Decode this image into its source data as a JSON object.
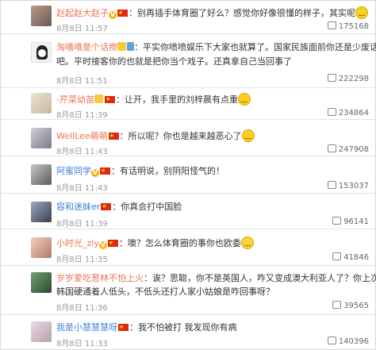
{
  "comments": [
    {
      "user": "赵起赵大赵子",
      "badges": [
        "vip-badge",
        "china-flag"
      ],
      "text": "：别再插手体育圈了好么？感觉你好像很懂的样子，其实呢",
      "emoji_after": true,
      "time": "8月8日 11:57",
      "likes": "175168"
    },
    {
      "user": "淘嘻嘻是个话痨",
      "badges": [
        "yellow-badge",
        "blue-badge"
      ],
      "text": "：平实你喷喷娱乐下大家也就算了。国家民族面前你还是少废话",
      "text2": "吧。平时接客你的也就是把你当个戏子。还真拿自己当回事了",
      "time": "8月8日 11:51",
      "likes": "222298"
    },
    {
      "user": "-芹菜幼苗",
      "badges": [
        "yellow-badge",
        "china-flag"
      ],
      "text": "：让开，我手里的刘梓晨有点重",
      "emoji_after": true,
      "time": "8月8日 11:39",
      "likes": "234864"
    },
    {
      "user": "WellLee萌萌",
      "badges": [
        "china-flag"
      ],
      "text": "：所以呢？你也是越来越恶心了",
      "emoji_after": true,
      "time": "8月8日 11:43",
      "likes": "247908"
    },
    {
      "user": "阿蜜同学",
      "badges": [
        "vip-badge",
        "china-flag"
      ],
      "text": "：有话明说，别阴阳怪气的！",
      "time": "8月8日 11:43",
      "likes": "153037"
    },
    {
      "user": "容和迷妹er",
      "badges": [
        "china-flag"
      ],
      "text": "：你真会打中国脸",
      "time": "8月8日 11:39",
      "likes": "96141"
    },
    {
      "user": "小时光_zly",
      "badges": [
        "vip-badge",
        "china-flag"
      ],
      "text": "：噢？怎么体育圈的事你也欧委",
      "laugh_after": true,
      "time": "8月8日 11:35",
      "likes": "41846"
    },
    {
      "user": "岁岁爱吃葱林不怕上火",
      "badges": [],
      "text": "：诶？思聪，你不是英国人，咋又变成澳大利亚人了？你上次在",
      "text2": "韩国硬通着人低头，不低头还打人家小姑娘是咋回事呀？",
      "time": "8月8日 11:36",
      "likes": "39565"
    },
    {
      "user": "我是小慧慧慧呀",
      "badges": [
        "china-flag"
      ],
      "text": "：我不怕被打 我发现你有病",
      "time": "8月8日 11:33",
      "likes": "140396"
    }
  ],
  "colors": {
    "username": "#eb7350",
    "username_blue": "#3e7ed3",
    "time": "#999999",
    "divider": "#e3e3e3"
  }
}
